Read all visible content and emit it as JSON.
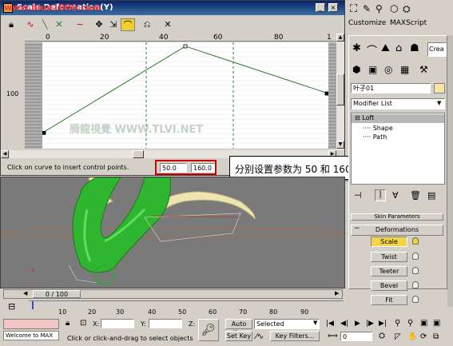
{
  "window": {
    "title": "Scale Deformation(Y)",
    "watermark": "www.blue1000.com"
  },
  "toolbar": {
    "icons": [
      "lock-icon",
      "curve-icon",
      "curve-alt-icon",
      "swap-icon",
      "swap2-icon",
      "move-point-icon",
      "scale-point-icon",
      "corner-point-icon",
      "delete-point-icon",
      "reset-icon"
    ]
  },
  "graph": {
    "ruler_ticks": [
      "0",
      "20",
      "40",
      "60",
      "80",
      "1"
    ],
    "y_label": "100",
    "curve_points": [
      [
        0,
        50
      ],
      [
        50,
        160
      ],
      [
        100,
        100
      ]
    ],
    "status": "Click on curve to insert control points.",
    "field_x": "50.0",
    "field_y": "160.0",
    "watermark": "腾龍視覺 WWW.TLVI.NET"
  },
  "callout": {
    "text": "分别设置参数为 50 和 160 调整控制点的位置。"
  },
  "menu": {
    "customize": "Customize",
    "maxscript": "MAXScript"
  },
  "command_panel": {
    "create_tab": "Crea",
    "object_name": "叶子01",
    "modifier_list": "Modifier List",
    "stack": [
      "Loft",
      "Shape",
      "Path"
    ],
    "skin_params": "Skin Parameters",
    "deformations_title": "Deformations",
    "deform_buttons": [
      "Scale",
      "Twist",
      "Teeter",
      "Bevel",
      "Fit"
    ]
  },
  "timeline": {
    "frame_label": "0 / 100",
    "ticks": [
      "10",
      "20",
      "30",
      "40",
      "50",
      "60",
      "70",
      "80",
      "90"
    ]
  },
  "status_bar": {
    "welcome": "Welcome to MAX",
    "x_label": "X:",
    "y_label": "Y:",
    "z_label": "Z:",
    "prompt": "Click or click-and-drag to select objects",
    "auto_key": "Auto Key",
    "set_key": "Set Key",
    "selected": "Selected",
    "key_filters": "Key Filters...",
    "frame": "0"
  },
  "colors": {
    "graph_bg": "#ffffff",
    "curve": "#2e7d32",
    "viewport_bg": "#777777",
    "callout_border": "#cc0000"
  }
}
